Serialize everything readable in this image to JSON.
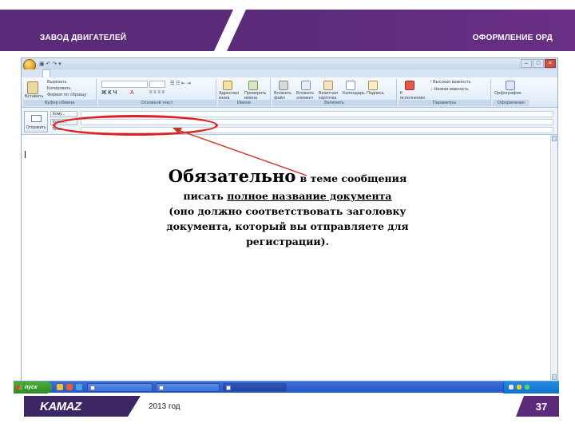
{
  "header": {
    "left_title": "ЗАВОД ДВИГАТЕЛЕЙ",
    "right_title": "ОФОРМЛЕНИЕ ОРД"
  },
  "outlook": {
    "ribbon_groups": {
      "clipboard": "Буфер обмена",
      "basic_text": "Основной текст",
      "names": "Имена",
      "include": "Включить",
      "options": "Параметры",
      "formatting": "Оформление"
    },
    "ribbon_buttons": {
      "paste": "Вставить",
      "cut": "Вырезать",
      "copy": "Копировать",
      "format_painter": "Формат по образцу",
      "address_book": "Адресная книга",
      "check_names": "Проверить имена",
      "attach_file": "Вложить файл",
      "attach_item": "Вложить элемент",
      "business_card": "Визитная карточка",
      "calendar": "Календарь",
      "signature": "Подпись",
      "follow_up": "К исполнению",
      "high_importance": "Высокая важность",
      "low_importance": "Низкая важность",
      "spelling": "Орфография"
    },
    "fields": {
      "send": "Отправить",
      "to_label": "Кому...",
      "cc_label": "Копия...",
      "subject_label": "Тема:"
    },
    "start_button": "пуск"
  },
  "callout": {
    "emphasis": "Обязательно",
    "line1_rest": "в теме сообщения",
    "line2_pre": "писать ",
    "line2_underlined": "полное название документа",
    "line3": "(оно должно соответствовать заголовку",
    "line4": "документа, который вы отправляете для",
    "line5": "регистрации)."
  },
  "colors": {
    "brand_purple": "#5b2a78",
    "highlight_red": "#e02121"
  },
  "footer": {
    "logo": "KAMAZ",
    "year": "2013 год",
    "page_number": "37"
  }
}
